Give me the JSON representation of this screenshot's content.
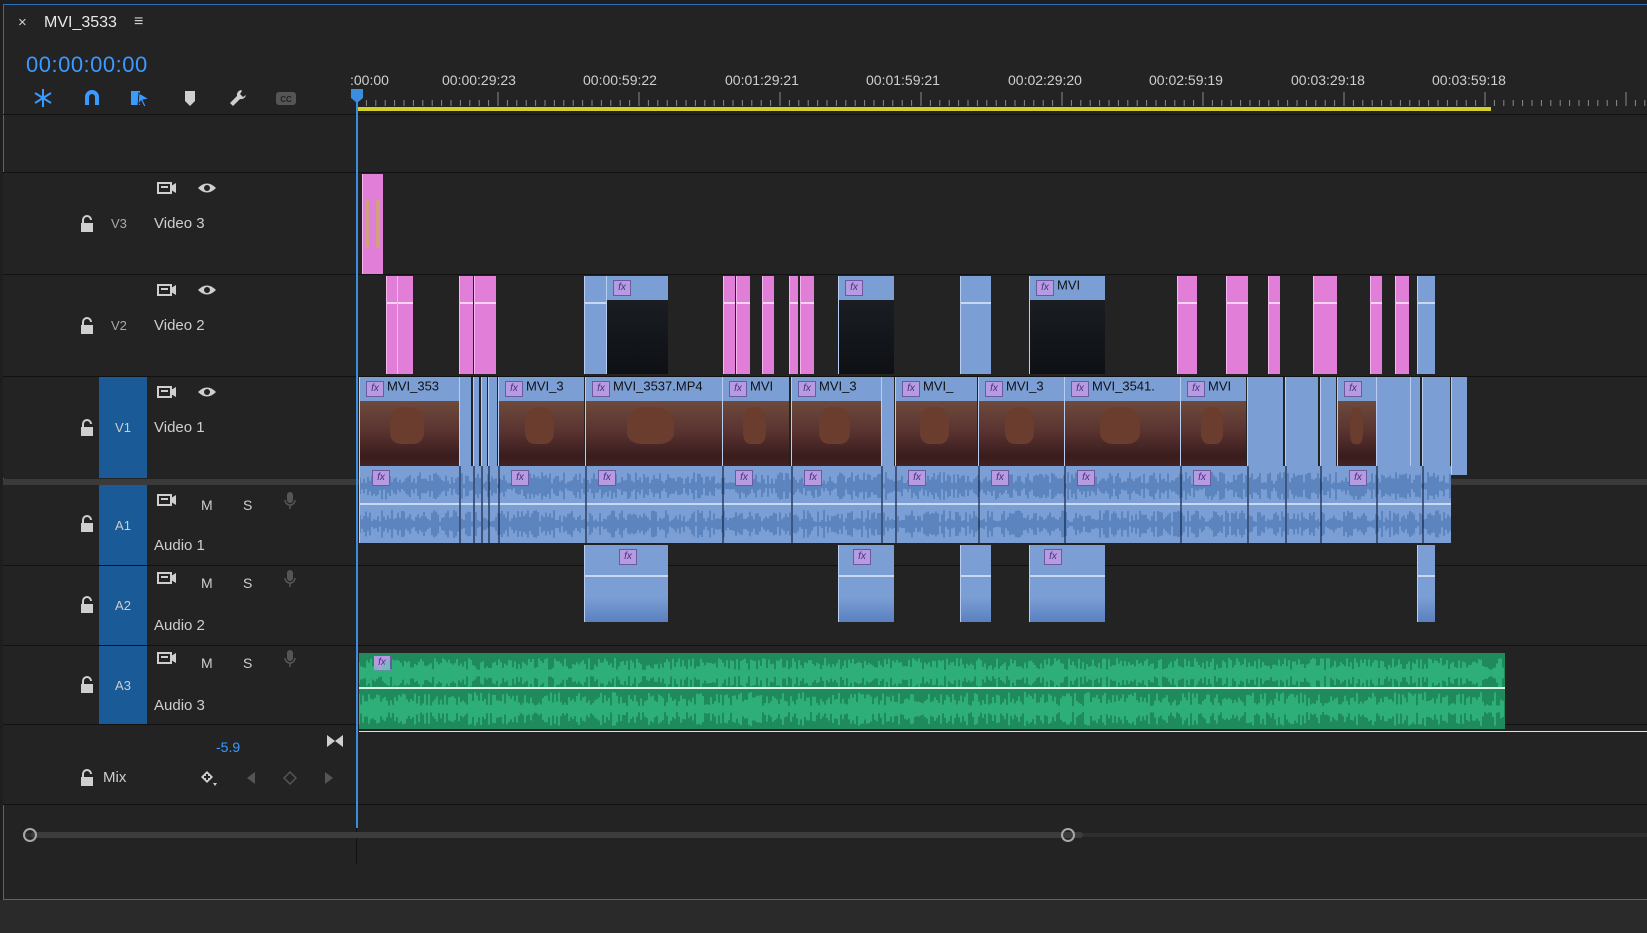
{
  "panel": {
    "close_glyph": "×",
    "sequence_name": "MVI_3533",
    "menu_glyph": "≡",
    "timecode": "00:00:00:00"
  },
  "toolbar": [
    {
      "name": "nest-toggle-icon",
      "active": true
    },
    {
      "name": "snap-magnet-icon",
      "active": true
    },
    {
      "name": "linked-selection-icon",
      "active": true
    },
    {
      "name": "add-marker-icon",
      "active": false
    },
    {
      "name": "timeline-settings-wrench-icon",
      "active": false
    },
    {
      "name": "captions-cc-icon",
      "active": false
    }
  ],
  "ruler": {
    "labels": [
      ":00:00",
      "00:00:29:23",
      "00:00:59:22",
      "00:01:29:21",
      "00:01:59:21",
      "00:02:29:20",
      "00:02:59:19",
      "00:03:29:18",
      "00:03:59:18"
    ]
  },
  "tracks": {
    "v3": {
      "id": "V3",
      "name": "Video 3"
    },
    "v2": {
      "id": "V2",
      "name": "Video 2"
    },
    "v1": {
      "id": "V1",
      "name": "Video 1"
    },
    "a1": {
      "id": "A1",
      "name": "Audio 1",
      "mute": "M",
      "solo": "S"
    },
    "a2": {
      "id": "A2",
      "name": "Audio 2",
      "mute": "M",
      "solo": "S"
    },
    "a3": {
      "id": "A3",
      "name": "Audio 3",
      "mute": "M",
      "solo": "S"
    },
    "mix": {
      "name": "Mix",
      "volume": "-5.9"
    }
  },
  "clips": {
    "v1_labels": [
      "MVI_353",
      "MVI_3",
      "MVI_3537.MP4",
      "MVI",
      "MVI_3",
      "MVI_",
      "MVI_3",
      "MVI_3541.",
      "MVI"
    ],
    "v2_label": "MVI",
    "fx": "fx"
  },
  "colors": {
    "accent": "#3b9aff",
    "video_clip": "#7b9fd4",
    "pink_clip": "#e07ed8",
    "music_clip": "#1f8a5b",
    "track_target": "#1a5a96",
    "work_area": "#d4cf2a"
  }
}
